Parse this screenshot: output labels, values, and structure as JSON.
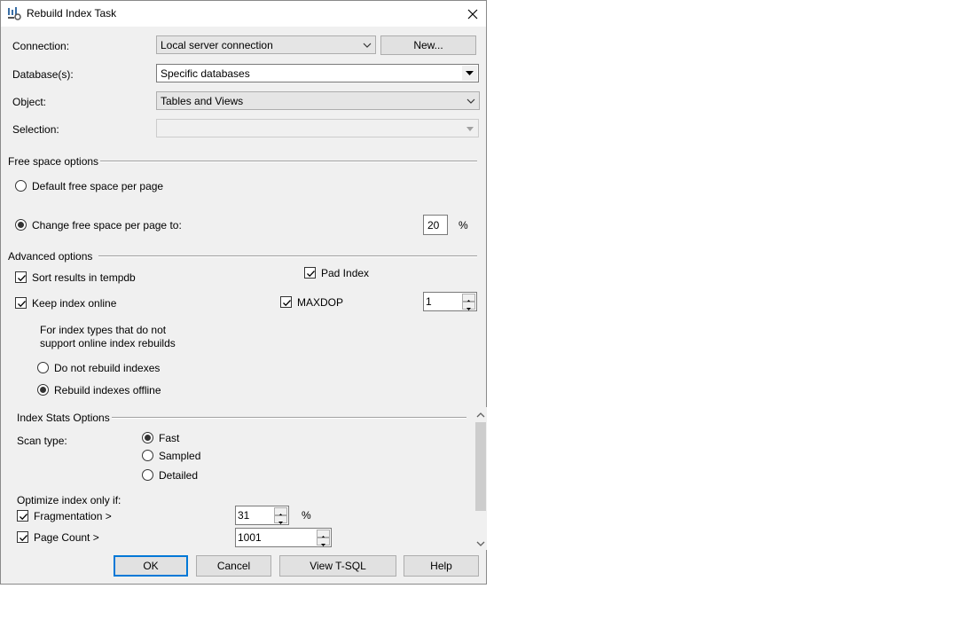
{
  "window": {
    "title": "Rebuild Index Task"
  },
  "connection": {
    "label": "Connection:",
    "value": "Local server connection",
    "new_button": "New..."
  },
  "databases": {
    "label": "Database(s):",
    "value": "Specific databases"
  },
  "object": {
    "label": "Object:",
    "value": "Tables and Views"
  },
  "selection": {
    "label": "Selection:",
    "value": ""
  },
  "free_space": {
    "title": "Free space options",
    "default_label": "Default free space per page",
    "change_label": "Change free space per page to:",
    "value": "20",
    "unit": "%"
  },
  "advanced": {
    "title": "Advanced options",
    "sort_tempdb": "Sort results in tempdb",
    "pad_index": "Pad Index",
    "keep_online": "Keep index online",
    "maxdop": "MAXDOP",
    "maxdop_value": "1",
    "note_line1": "For index types that do not",
    "note_line2": "support online index rebuilds",
    "do_not_rebuild": "Do not rebuild indexes",
    "rebuild_offline": "Rebuild indexes offline"
  },
  "stats": {
    "title": "Index Stats Options",
    "scan_type_label": "Scan type:",
    "fast": "Fast",
    "sampled": "Sampled",
    "detailed": "Detailed",
    "optimize_label": "Optimize index only if:",
    "fragmentation_label": "Fragmentation >",
    "fragmentation_value": "31",
    "fragmentation_unit": "%",
    "page_count_label": "Page Count >",
    "page_count_value": "1001"
  },
  "buttons": {
    "ok": "OK",
    "cancel": "Cancel",
    "view_tsql": "View T-SQL",
    "help": "Help"
  }
}
